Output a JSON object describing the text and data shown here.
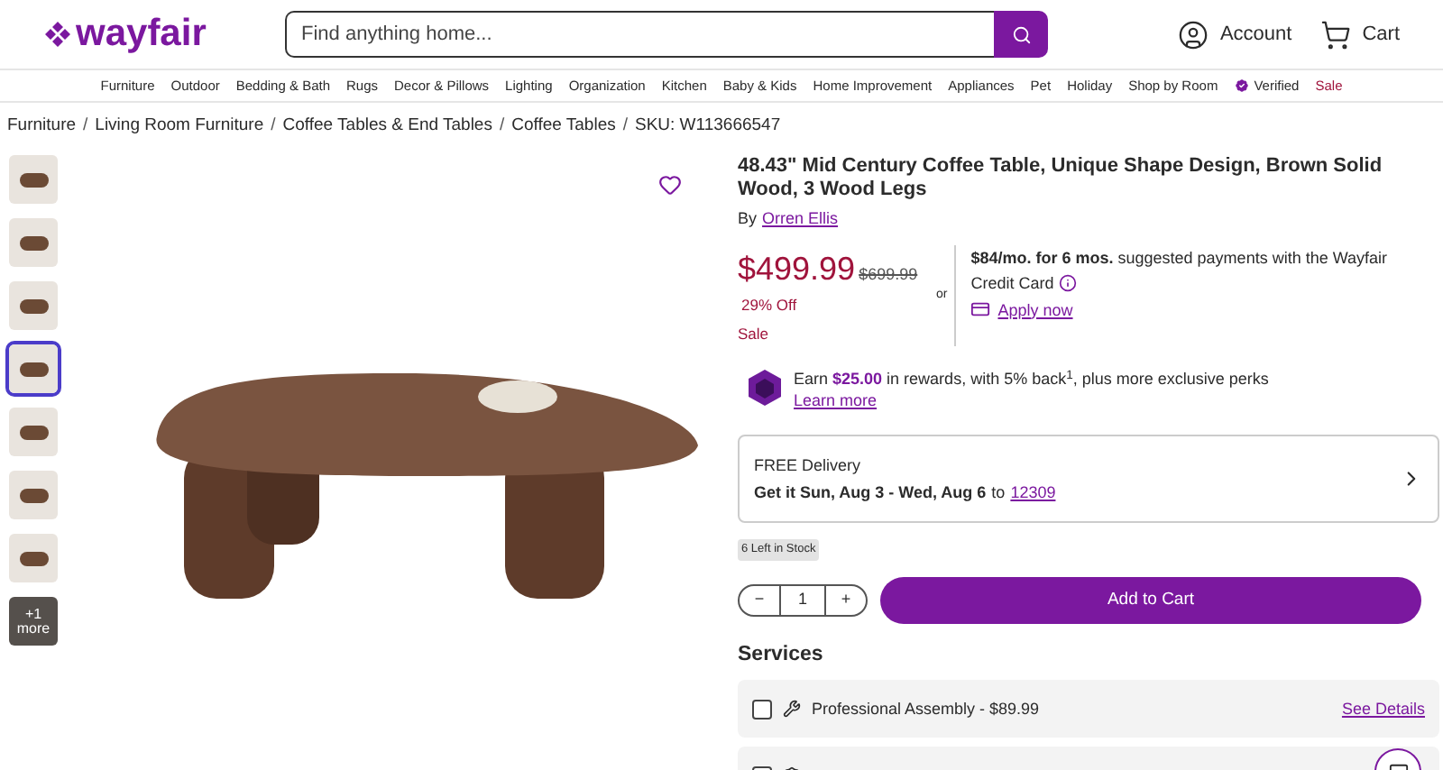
{
  "header": {
    "logo": "wayfair",
    "search": {
      "placeholder": "Find anything home..."
    },
    "account": "Account",
    "cart": "Cart"
  },
  "nav": [
    {
      "label": "Furniture",
      "kind": "plain"
    },
    {
      "label": "Outdoor",
      "kind": "plain"
    },
    {
      "label": "Bedding & Bath",
      "kind": "plain"
    },
    {
      "label": "Rugs",
      "kind": "plain"
    },
    {
      "label": "Decor & Pillows",
      "kind": "plain"
    },
    {
      "label": "Lighting",
      "kind": "plain"
    },
    {
      "label": "Organization",
      "kind": "plain"
    },
    {
      "label": "Kitchen",
      "kind": "plain"
    },
    {
      "label": "Baby & Kids",
      "kind": "plain"
    },
    {
      "label": "Home Improvement",
      "kind": "plain"
    },
    {
      "label": "Appliances",
      "kind": "plain"
    },
    {
      "label": "Pet",
      "kind": "plain"
    },
    {
      "label": "Holiday",
      "kind": "plain"
    },
    {
      "label": "Shop by Room",
      "kind": "plain"
    },
    {
      "label": "Verified",
      "kind": "verified"
    },
    {
      "label": "Sale",
      "kind": "sale"
    }
  ],
  "breadcrumb": {
    "separator": "/",
    "items": [
      "Furniture",
      "Living Room Furniture",
      "Coffee Tables & End Tables",
      "Coffee Tables"
    ]
  },
  "sku": "SKU: W113666547",
  "thumbnails": [
    {
      "selected": false
    },
    {
      "selected": false
    },
    {
      "selected": false
    },
    {
      "selected": true
    },
    {
      "selected": false
    },
    {
      "selected": false
    },
    {
      "selected": false
    },
    {
      "selected": false,
      "overlay": "+1 more"
    }
  ],
  "product": {
    "title": "48.43\" Mid Century Coffee Table, Unique Shape Design, Brown Solid Wood, 3 Wood Legs",
    "by": "By",
    "brand": "Orren Ellis",
    "price": "$499.99",
    "was_price": "$699.99",
    "discount": "29% Off",
    "badge": "Sale",
    "or": "or",
    "financing": "**$84/mo. for 6 mos.** suggested payments with the Wayfair",
    "financing_2": "Credit Card",
    "apply": "Apply now",
    "rewards": "Earn **$25.00** in rewards, with 5% back$^{1}$, plus more exclusive perks",
    "learn_more": "Learn more"
  },
  "delivery": {
    "title": "FREE Delivery",
    "text": "Get it Sun, Aug 3 - Wed, Aug 6",
    "to": "to",
    "zip": "12309"
  },
  "stock": "6 Left in Stock",
  "quantity": {
    "minus": "−",
    "value": "1",
    "plus": "+"
  },
  "add_to_cart": "Add to Cart",
  "services": {
    "title": "Services",
    "items": [
      {
        "label": "Professional Assembly - $89.99",
        "checked": false,
        "link": "See Details"
      }
    ],
    "cut_row": {
      "checked": false
    }
  }
}
